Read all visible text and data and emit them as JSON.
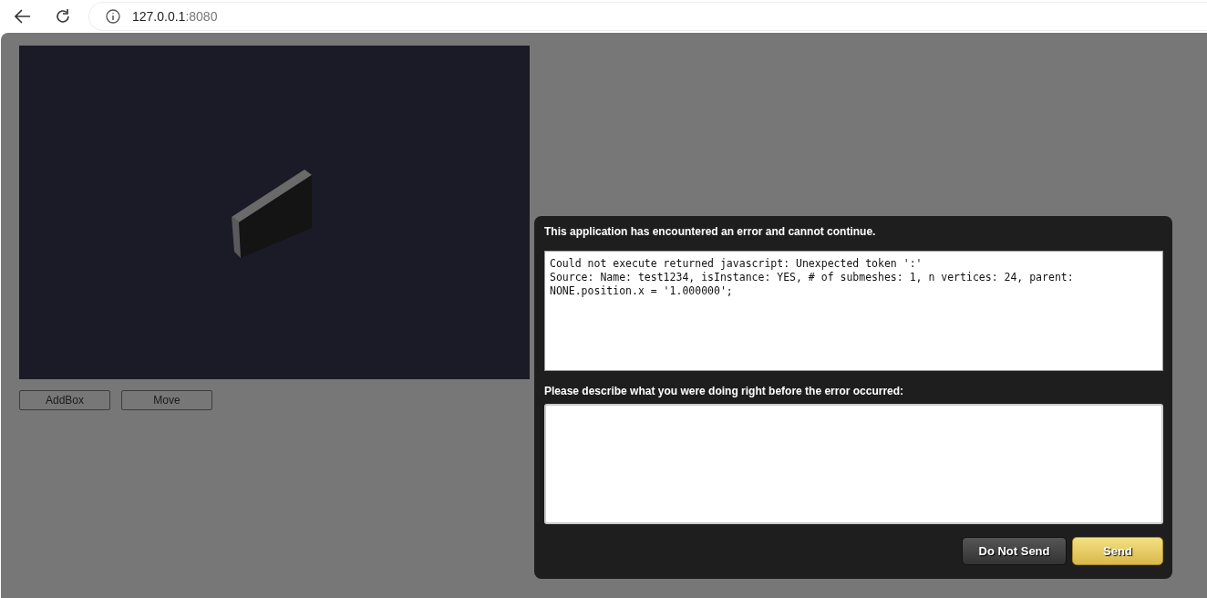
{
  "browser": {
    "host": "127.0.0.1",
    "port": ":8080"
  },
  "toolbar": {
    "buttons": [
      "AddBox",
      "Move"
    ]
  },
  "error_dialog": {
    "title": "This application has encountered an error and cannot continue.",
    "details": "Could not execute returned javascript: Unexpected token ':'\nSource: Name: test1234, isInstance: YES, # of submeshes: 1, n vertices: 24, parent: NONE.position.x = '1.000000';",
    "prompt": "Please describe what you were doing right before the error occurred:",
    "buttons": [
      {
        "label": "Do Not Send",
        "kind": "secondary"
      },
      {
        "label": "Send",
        "kind": "primary"
      }
    ]
  }
}
